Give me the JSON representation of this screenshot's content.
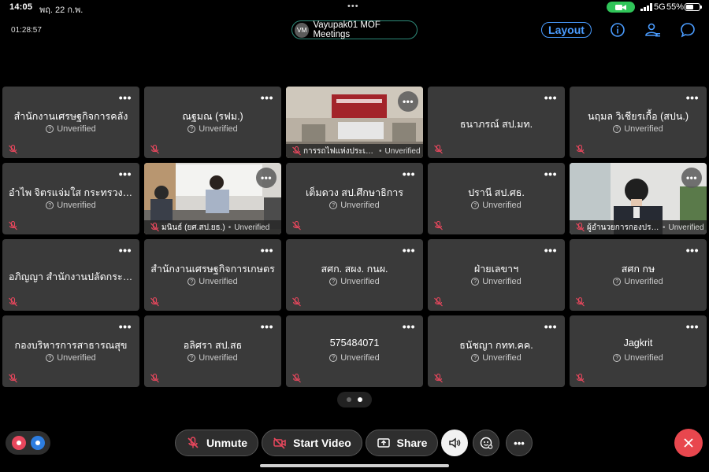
{
  "status_bar": {
    "time": "14:05",
    "date": "พฤ. 22 ก.พ.",
    "dots": "•••",
    "network": "5G",
    "battery": "55%"
  },
  "meeting": {
    "timer": "01:28:57",
    "host_initials": "VM",
    "title": "Vayupak01 MOF Meetings",
    "layout_label": "Layout"
  },
  "tiles": [
    {
      "name": "สำนักงานเศรษฐกิจการคลัง",
      "status": "Unverified",
      "video": false
    },
    {
      "name": "ณฐมณ (รฟม.)",
      "status": "Unverified",
      "video": false
    },
    {
      "name": "การรถไฟแห่งประเทศไทย",
      "status": "Unverified",
      "video": true
    },
    {
      "name": "ธนาภรณ์ สป.มท.",
      "status": "",
      "video": false
    },
    {
      "name": "นฤมล วิเชียรเกื้อ (สปน.)",
      "status": "Unverified",
      "video": false
    },
    {
      "name": "อำไพ จิตรแจ่มใส กระทรวงการคลัง",
      "status": "Unverified",
      "video": false
    },
    {
      "name": "มนินธ์ (ยศ.สป.ยธ.)",
      "status": "Unverified",
      "video": true
    },
    {
      "name": "เต็มดวง สป.ศึกษาธิการ",
      "status": "Unverified",
      "video": false
    },
    {
      "name": "ปรานี สป.ศธ.",
      "status": "Unverified",
      "video": false
    },
    {
      "name": "ผู้อำนวยการกองประเมินผล",
      "status": "Unverified",
      "video": true
    },
    {
      "name": "อภิญญา สำนักงานปลัดกระทรวง",
      "status": "",
      "video": false
    },
    {
      "name": "สำนักงานเศรษฐกิจการเกษตร",
      "status": "Unverified",
      "video": false
    },
    {
      "name": "สศก. สผง. กนผ.",
      "status": "Unverified",
      "video": false
    },
    {
      "name": "ฝ่ายเลขาฯ",
      "status": "Unverified",
      "video": false
    },
    {
      "name": "สศก กษ",
      "status": "Unverified",
      "video": false
    },
    {
      "name": "กองบริหารการสาธารณสุข",
      "status": "Unverified",
      "video": false
    },
    {
      "name": "อลิศรา สป.สธ",
      "status": "Unverified",
      "video": false
    },
    {
      "name": "575484071",
      "status": "Unverified",
      "video": false
    },
    {
      "name": "ธนัชญา กทท.คค.",
      "status": "Unverified",
      "video": false
    },
    {
      "name": "Jagkrit",
      "status": "Unverified",
      "video": false
    }
  ],
  "tile_more": "•••",
  "controls": {
    "unmute": "Unmute",
    "start_video": "Start Video",
    "share": "Share",
    "more": "•••"
  },
  "pages": {
    "count": 2,
    "current": 2
  },
  "colors": {
    "tile_bg": "#3a3a3a",
    "accent_blue": "#4a9cff",
    "end_red": "#e8474e",
    "mute_red": "#e8475d",
    "battery_green": "#30c559"
  }
}
